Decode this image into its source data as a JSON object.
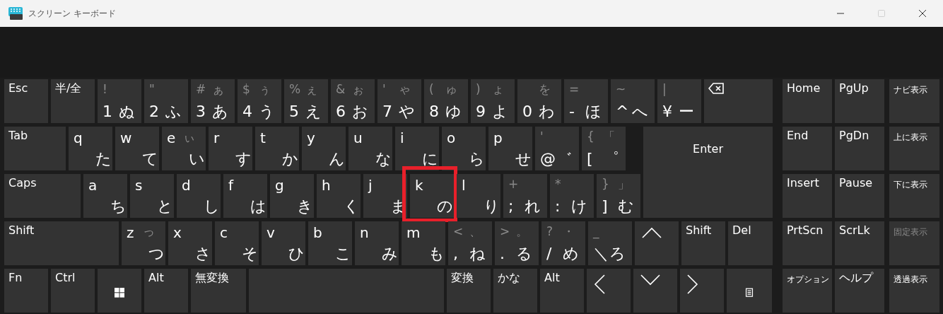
{
  "window": {
    "title": "スクリーン キーボード",
    "controls": [
      {
        "kind": "minimize",
        "disabled": false
      },
      {
        "kind": "maximize",
        "disabled": true
      },
      {
        "kind": "close",
        "disabled": false
      }
    ]
  },
  "rows": [
    {
      "keys": [
        {
          "kind": "label",
          "label": "Esc",
          "highlighted": false
        },
        {
          "kind": "label",
          "label": "半/全",
          "highlighted": false
        },
        {
          "kind": "symbol",
          "tl": "!",
          "bl": "1",
          "br": "ぬ",
          "highlighted": false
        },
        {
          "kind": "symbol",
          "tl": "\"",
          "bl": "2",
          "br": "ふ",
          "highlighted": false
        },
        {
          "kind": "symbol",
          "tl": "#",
          "tr": "ぁ",
          "bl": "3",
          "br": "あ",
          "highlighted": false
        },
        {
          "kind": "symbol",
          "tl": "$",
          "tr": "ぅ",
          "bl": "4",
          "br": "う",
          "highlighted": false
        },
        {
          "kind": "symbol",
          "tl": "%",
          "tr": "ぇ",
          "bl": "5",
          "br": "え",
          "highlighted": false
        },
        {
          "kind": "symbol",
          "tl": "&",
          "tr": "ぉ",
          "bl": "6",
          "br": "お",
          "highlighted": false
        },
        {
          "kind": "symbol",
          "tl": "'",
          "tr": "ゃ",
          "bl": "7",
          "br": "や",
          "highlighted": false
        },
        {
          "kind": "symbol",
          "tl": "(",
          "tr": "ゅ",
          "bl": "8",
          "br": "ゆ",
          "highlighted": false
        },
        {
          "kind": "symbol",
          "tl": ")",
          "tr": "ょ",
          "bl": "9",
          "br": "よ",
          "highlighted": false
        },
        {
          "kind": "symbol",
          "tr": "を",
          "bl": "0",
          "br": "わ",
          "highlighted": false
        },
        {
          "kind": "symbol",
          "tl": "=",
          "bl": "-",
          "br": "ほ",
          "highlighted": false
        },
        {
          "kind": "symbol",
          "tl": "~",
          "bl": "^",
          "br": "へ",
          "highlighted": false
        },
        {
          "kind": "symbol",
          "tl": "|",
          "bl": "¥",
          "br": "ー",
          "highlighted": false
        },
        {
          "kind": "backspace",
          "highlighted": false
        }
      ]
    },
    {
      "keys": [
        {
          "kind": "label",
          "label": "Tab",
          "highlighted": false
        },
        {
          "kind": "letter",
          "tl": "q",
          "br": "た",
          "highlighted": false
        },
        {
          "kind": "letter",
          "tl": "w",
          "br": "て",
          "highlighted": false
        },
        {
          "kind": "letter",
          "tl": "e",
          "tr": "ぃ",
          "br": "い",
          "highlighted": false
        },
        {
          "kind": "letter",
          "tl": "r",
          "br": "す",
          "highlighted": false
        },
        {
          "kind": "letter",
          "tl": "t",
          "br": "か",
          "highlighted": false
        },
        {
          "kind": "letter",
          "tl": "y",
          "br": "ん",
          "highlighted": false
        },
        {
          "kind": "letter",
          "tl": "u",
          "br": "な",
          "highlighted": false
        },
        {
          "kind": "letter",
          "tl": "i",
          "br": "に",
          "highlighted": false
        },
        {
          "kind": "letter",
          "tl": "o",
          "br": "ら",
          "highlighted": false
        },
        {
          "kind": "letter",
          "tl": "p",
          "br": "せ",
          "highlighted": false
        },
        {
          "kind": "symbol",
          "tl": "'",
          "bl": "@",
          "br": "゛",
          "highlighted": false
        },
        {
          "kind": "symbol",
          "tl": "{",
          "tr": "「",
          "bl": "[",
          "br": "゜",
          "highlighted": false
        },
        {
          "kind": "enter",
          "label": "Enter",
          "highlighted": false
        }
      ]
    },
    {
      "keys": [
        {
          "kind": "label",
          "label": "Caps",
          "highlighted": false
        },
        {
          "kind": "letter",
          "tl": "a",
          "br": "ち",
          "highlighted": false
        },
        {
          "kind": "letter",
          "tl": "s",
          "br": "と",
          "highlighted": false
        },
        {
          "kind": "letter",
          "tl": "d",
          "br": "し",
          "highlighted": false
        },
        {
          "kind": "letter",
          "tl": "f",
          "br": "は",
          "highlighted": false
        },
        {
          "kind": "letter",
          "tl": "g",
          "br": "き",
          "highlighted": false
        },
        {
          "kind": "letter",
          "tl": "h",
          "br": "く",
          "highlighted": false
        },
        {
          "kind": "letter",
          "tl": "j",
          "br": "ま",
          "highlighted": false
        },
        {
          "kind": "letter",
          "tl": "k",
          "br": "の",
          "highlighted": true
        },
        {
          "kind": "letter",
          "tl": "l",
          "br": "り",
          "highlighted": false
        },
        {
          "kind": "symbol",
          "tl": "+",
          "bl": ";",
          "br": "れ",
          "highlighted": false
        },
        {
          "kind": "symbol",
          "tl": "*",
          "bl": ":",
          "br": "け",
          "highlighted": false
        },
        {
          "kind": "symbol",
          "tl": "}",
          "tr": "」",
          "bl": "]",
          "br": "む",
          "highlighted": false
        }
      ]
    },
    {
      "keys": [
        {
          "kind": "label",
          "label": "Shift",
          "highlighted": false
        },
        {
          "kind": "letter",
          "tl": "z",
          "tr": "っ",
          "br": "つ",
          "highlighted": false
        },
        {
          "kind": "letter",
          "tl": "x",
          "br": "さ",
          "highlighted": false
        },
        {
          "kind": "letter",
          "tl": "c",
          "br": "そ",
          "highlighted": false
        },
        {
          "kind": "letter",
          "tl": "v",
          "br": "ひ",
          "highlighted": false
        },
        {
          "kind": "letter",
          "tl": "b",
          "br": "こ",
          "highlighted": false
        },
        {
          "kind": "letter",
          "tl": "n",
          "br": "み",
          "highlighted": false
        },
        {
          "kind": "letter",
          "tl": "m",
          "br": "も",
          "highlighted": false
        },
        {
          "kind": "symbol",
          "tl": "<",
          "tr": "、",
          "bl": ",",
          "br": "ね",
          "highlighted": false
        },
        {
          "kind": "symbol",
          "tl": ">",
          "tr": "。",
          "bl": ".",
          "br": "る",
          "highlighted": false
        },
        {
          "kind": "symbol",
          "tl": "?",
          "tr": "・",
          "bl": "/",
          "br": "め",
          "highlighted": false
        },
        {
          "kind": "symbol",
          "tl": "_",
          "bl": "＼",
          "br": "ろ",
          "highlighted": false
        },
        {
          "kind": "arrow-up",
          "highlighted": false
        },
        {
          "kind": "label",
          "label": "Shift",
          "highlighted": false
        },
        {
          "kind": "label",
          "label": "Del",
          "highlighted": false
        }
      ]
    },
    {
      "keys": [
        {
          "kind": "label",
          "label": "Fn",
          "highlighted": false
        },
        {
          "kind": "label",
          "label": "Ctrl",
          "highlighted": false
        },
        {
          "kind": "windows",
          "highlighted": false
        },
        {
          "kind": "label",
          "label": "Alt",
          "highlighted": false
        },
        {
          "kind": "label",
          "label": "無変換",
          "highlighted": false
        },
        {
          "kind": "space",
          "highlighted": false
        },
        {
          "kind": "label",
          "label": "変換",
          "highlighted": false
        },
        {
          "kind": "label",
          "label": "かな",
          "highlighted": false
        },
        {
          "kind": "label",
          "label": "Alt",
          "highlighted": false
        },
        {
          "kind": "arrow-left",
          "highlighted": false
        },
        {
          "kind": "arrow-down",
          "highlighted": false
        },
        {
          "kind": "arrow-right",
          "highlighted": false
        },
        {
          "kind": "menu",
          "highlighted": false
        }
      ]
    }
  ],
  "side_rows": [
    {
      "keys": [
        {
          "label": "Home",
          "kind": "label",
          "disabled": false
        },
        {
          "label": "PgUp",
          "kind": "label",
          "disabled": false
        },
        {
          "label": "ナビ表示",
          "kind": "option",
          "disabled": false
        }
      ]
    },
    {
      "keys": [
        {
          "label": "End",
          "kind": "label",
          "disabled": false
        },
        {
          "label": "PgDn",
          "kind": "label",
          "disabled": false
        },
        {
          "label": "上に表示",
          "kind": "option",
          "disabled": false
        }
      ]
    },
    {
      "keys": [
        {
          "label": "Insert",
          "kind": "label",
          "disabled": false
        },
        {
          "label": "Pause",
          "kind": "label",
          "disabled": false
        },
        {
          "label": "下に表示",
          "kind": "option",
          "disabled": false
        }
      ]
    },
    {
      "keys": [
        {
          "label": "PrtScn",
          "kind": "label",
          "disabled": false
        },
        {
          "label": "ScrLk",
          "kind": "label",
          "disabled": false
        },
        {
          "label": "固定表示",
          "kind": "option",
          "disabled": true
        }
      ]
    },
    {
      "keys": [
        {
          "label": "オプション",
          "kind": "option",
          "disabled": false
        },
        {
          "label": "ヘルプ",
          "kind": "label",
          "disabled": false
        },
        {
          "label": "透過表示",
          "kind": "option",
          "disabled": false
        }
      ]
    }
  ]
}
